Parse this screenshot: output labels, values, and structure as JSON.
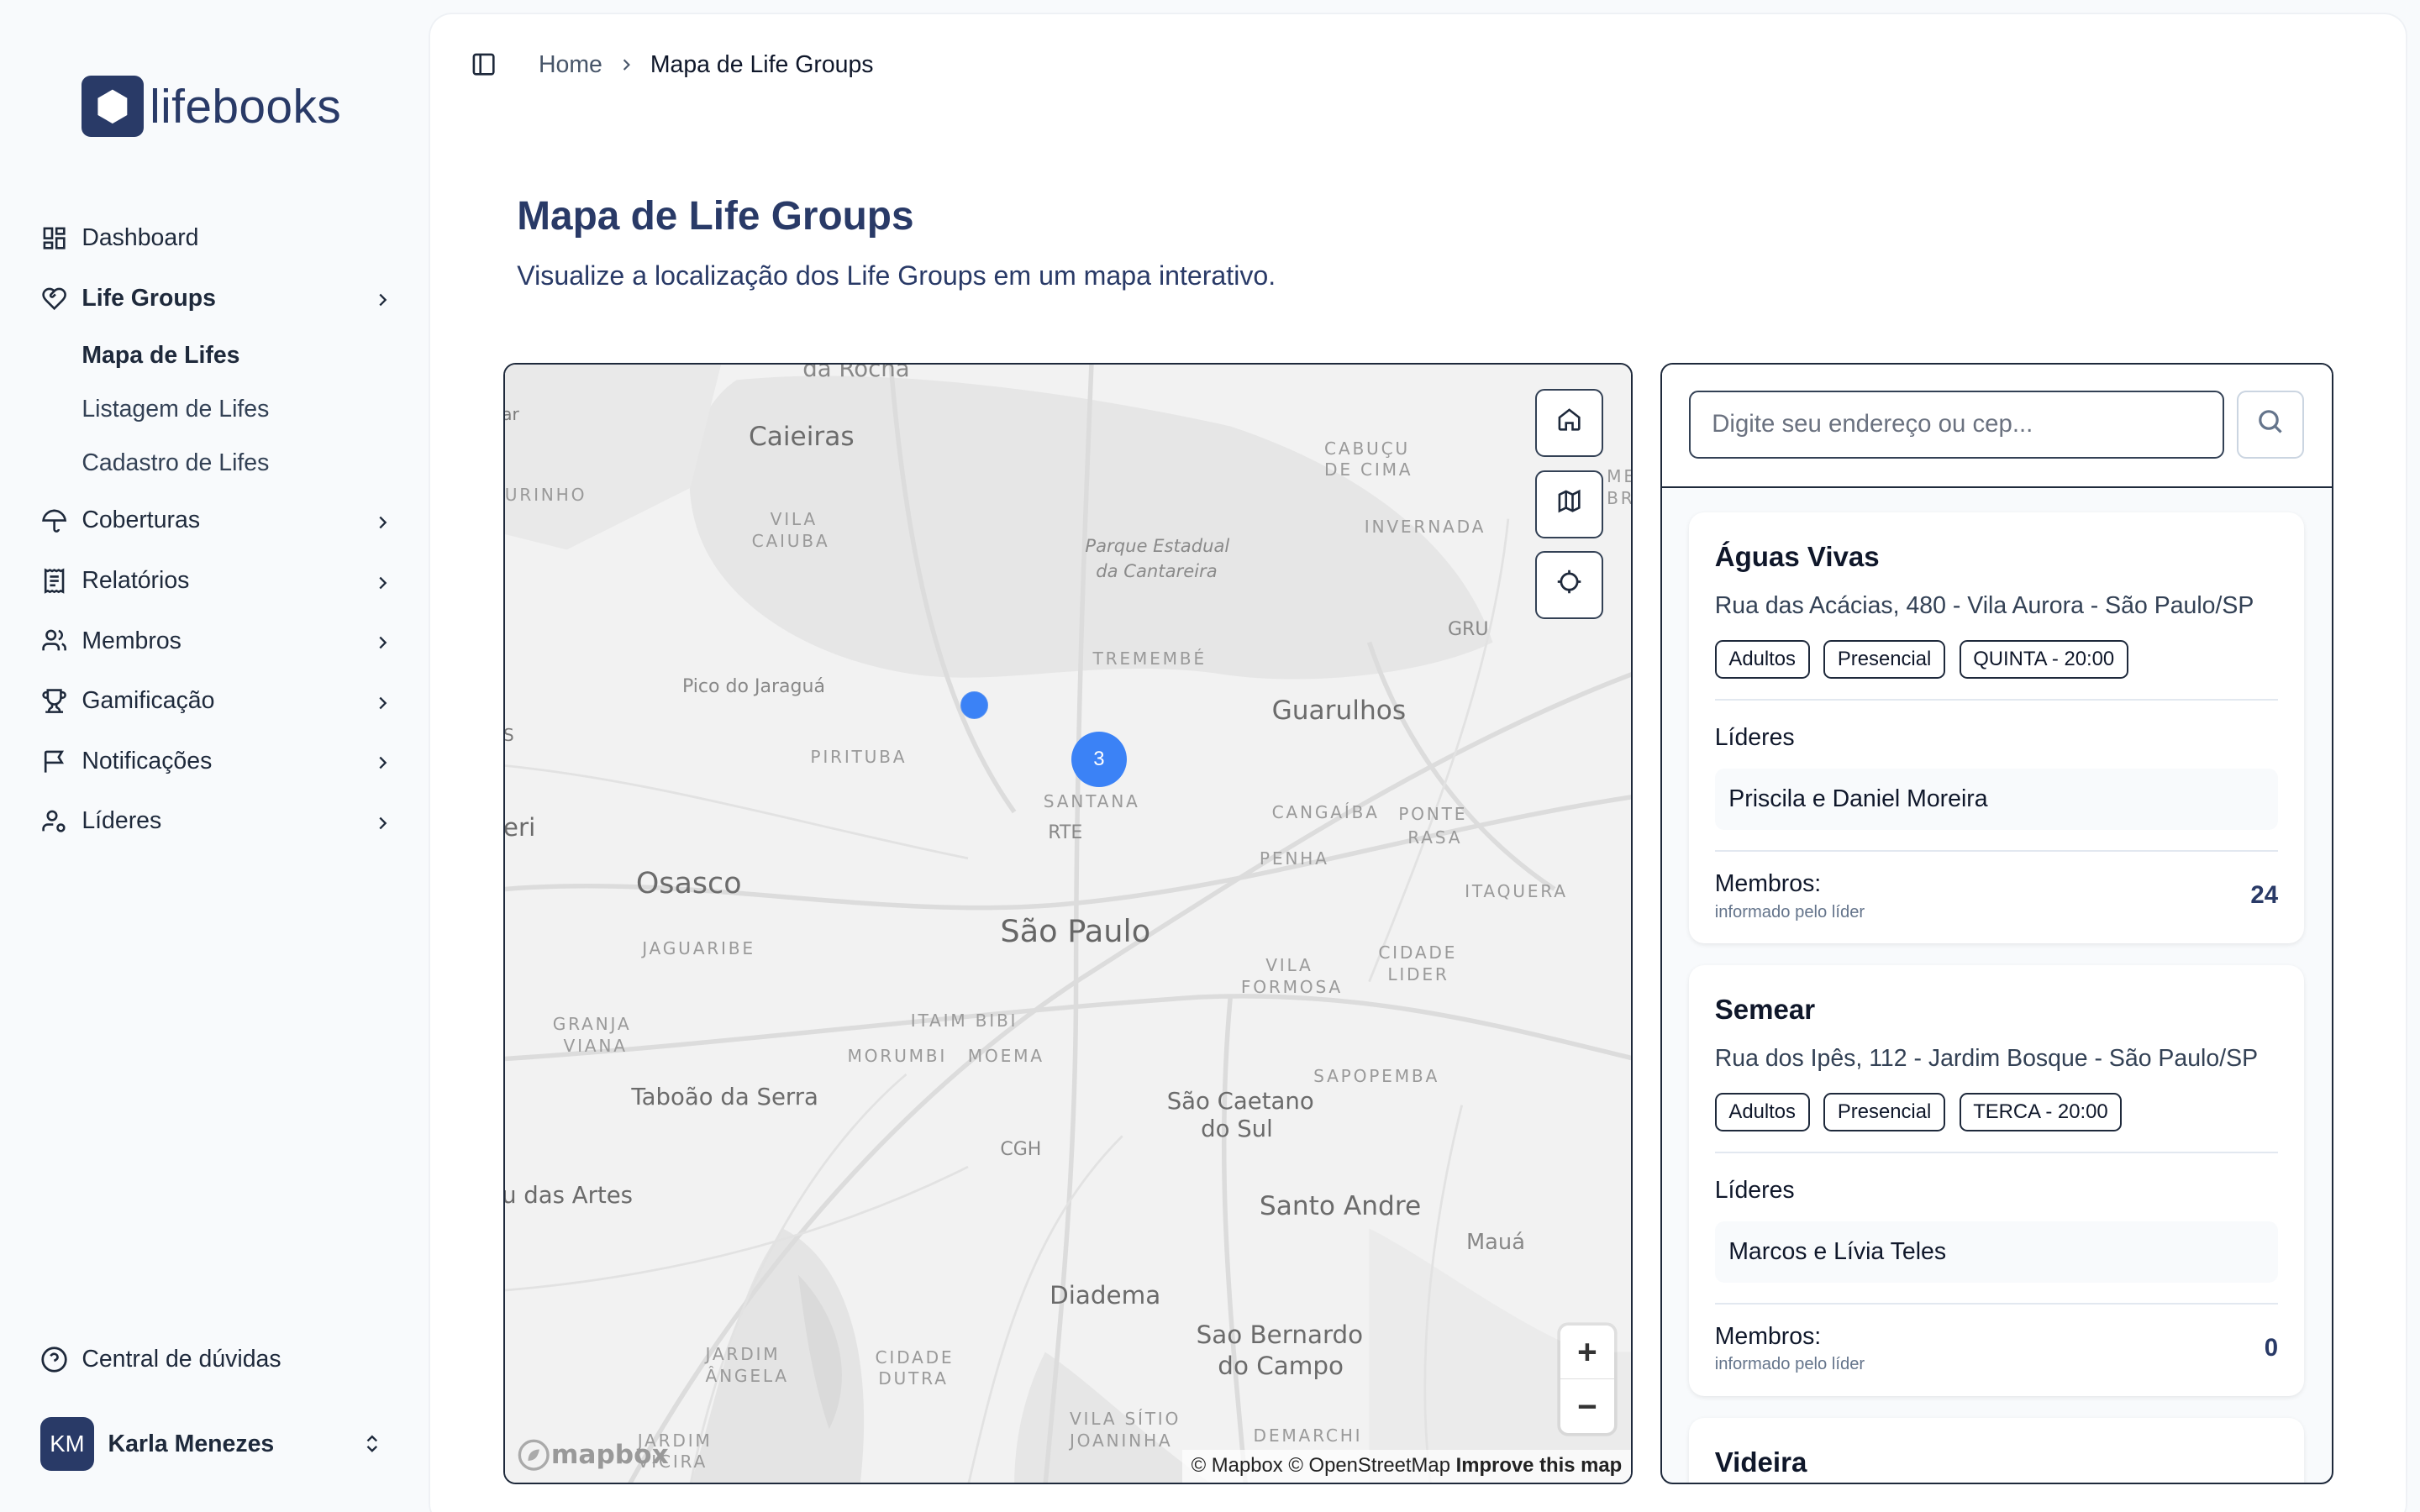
{
  "brand": {
    "name": "lifebooks",
    "color": "#293a67"
  },
  "sidebar": {
    "items": [
      {
        "label": "Dashboard",
        "icon": "dashboard-icon"
      },
      {
        "label": "Life Groups",
        "icon": "heart-handshake-icon",
        "expanded": true
      },
      {
        "label": "Coberturas",
        "icon": "umbrella-icon"
      },
      {
        "label": "Relatórios",
        "icon": "receipt-icon"
      },
      {
        "label": "Membros",
        "icon": "users-icon"
      },
      {
        "label": "Gamificação",
        "icon": "trophy-icon"
      },
      {
        "label": "Notificações",
        "icon": "flag-icon"
      },
      {
        "label": "Líderes",
        "icon": "user-cog-icon"
      }
    ],
    "subitems": [
      {
        "label": "Mapa de Lifes",
        "active": true
      },
      {
        "label": "Listagem de Lifes"
      },
      {
        "label": "Cadastro de Lifes"
      }
    ],
    "help": "Central de dúvidas",
    "user": {
      "initials": "KM",
      "name": "Karla Menezes"
    }
  },
  "breadcrumb": {
    "home": "Home",
    "current": "Mapa de Life Groups"
  },
  "page": {
    "title": "Mapa de Life Groups",
    "subtitle": "Visualize a localização dos Life Groups em um mapa interativo."
  },
  "map": {
    "labels": {
      "da_rocha": "da Rocha",
      "caieiras": "Caieiras",
      "cabucu": "CABUÇU",
      "de_cima": "DE CIMA",
      "urinho": "URINHO",
      "vila": "VILA",
      "caiuba": "CAIUBA",
      "parque1": "Parque Estadual",
      "parque2": "da Cantareira",
      "invernada": "INVERNADA",
      "gru": "GRU",
      "tremembe": "TREMEMBÉ",
      "jaragua": "Pico do Jaraguá",
      "guarulhos": "Guarulhos",
      "pirituba": "PIRITUBA",
      "santana": "SANTANA",
      "rte": "RTE",
      "cangaiba": "CANGAÍBA",
      "ponte": "PONTE",
      "rasa": "RASA",
      "penha": "PENHA",
      "osasco": "Osasco",
      "sao_paulo": "São Paulo",
      "itaquera": "ITAQUERA",
      "jaguaribe": "JAGUARIBE",
      "vila2": "VILA",
      "formosa": "FORMOSA",
      "cidade": "CIDADE",
      "lider": "LIDER",
      "granja": "GRANJA",
      "viana": "VIANA",
      "itaim": "ITAIM BIBI",
      "morumbi": "MORUMBI",
      "moema": "MOEMA",
      "sapopemba": "SAPOPEMBA",
      "taboao": "Taboão da Serra",
      "scaetano1": "São Caetano",
      "scaetano2": "do Sul",
      "cgh": "CGH",
      "embu": "u das Artes",
      "santo_andre": "Santo Andre",
      "maua": "Mauá",
      "diadema": "Diadema",
      "sbc1": "Sao Bernardo",
      "sbc2": "do Campo",
      "jardim": "JARDIM",
      "angela": "ÂNGELA",
      "cidade2": "CIDADE",
      "dutra": "DUTRA",
      "vila_sitio": "VILA SÍTIO",
      "joaninha": "JOANINHA",
      "demarchi": "DEMARCHI",
      "jardim2": "JARDIM",
      "vicira": "VICIRA",
      "eri": "eri",
      "ar": "ar",
      "s": "S",
      "aeso": "MESO",
      "bra": "BRA"
    },
    "cluster_count": "3",
    "mapbox_logo": "mapbox",
    "attribution": {
      "mapbox": "© Mapbox",
      "osm": "© OpenStreetMap",
      "improve": "Improve this map"
    },
    "zoom_in": "+",
    "zoom_out": "−"
  },
  "search": {
    "placeholder": "Digite seu endereço ou cep..."
  },
  "cards": [
    {
      "name": "Águas Vivas",
      "address": "Rua das Acácias, 480 - Vila Aurora - São Paulo/SP",
      "tags": [
        "Adultos",
        "Presencial",
        "QUINTA - 20:00"
      ],
      "leaders_label": "Líderes",
      "leaders": "Priscila e Daniel Moreira",
      "members_label": "Membros:",
      "members_note": "informado pelo líder",
      "members_count": "24"
    },
    {
      "name": "Semear",
      "address": "Rua dos Ipês, 112 - Jardim Bosque - São Paulo/SP",
      "tags": [
        "Adultos",
        "Presencial",
        "TERCA - 20:00"
      ],
      "leaders_label": "Líderes",
      "leaders": "Marcos e Lívia Teles",
      "members_label": "Membros:",
      "members_note": "informado pelo líder",
      "members_count": "0"
    },
    {
      "name": "Videira"
    }
  ]
}
